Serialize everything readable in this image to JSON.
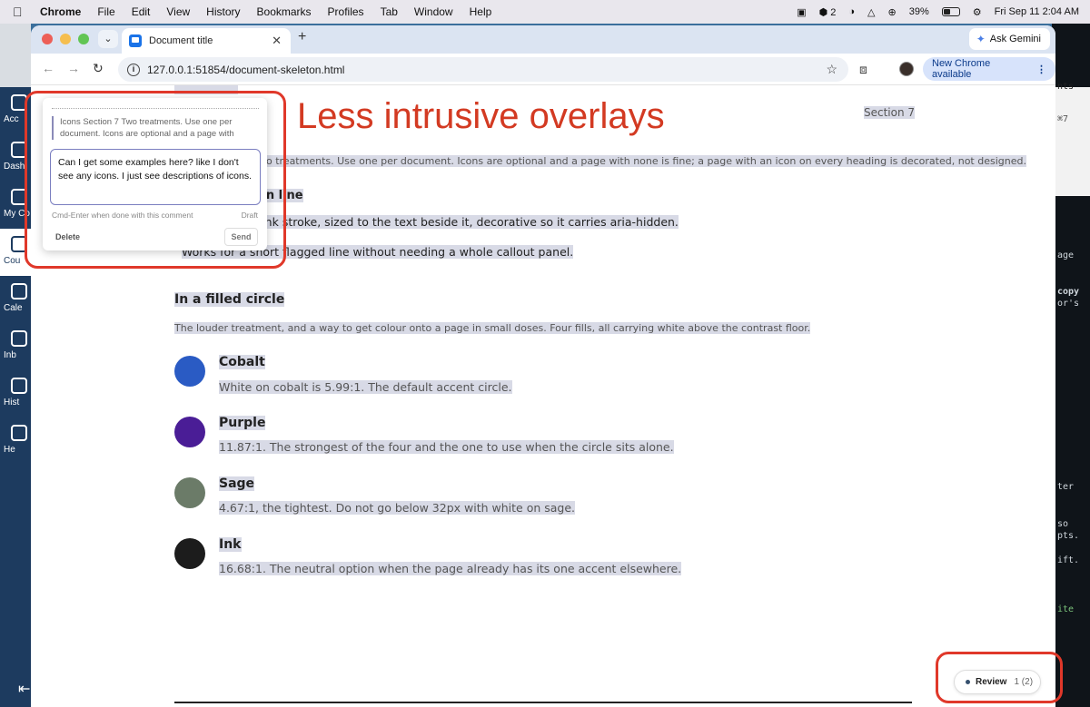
{
  "menubar": {
    "app": "Chrome",
    "items": [
      "File",
      "Edit",
      "View",
      "History",
      "Bookmarks",
      "Profiles",
      "Tab",
      "Window",
      "Help"
    ],
    "status_count": "2",
    "battery": "39%",
    "datetime": "Fri Sep 11  2:04 AM"
  },
  "left_app": {
    "items": [
      "Acc",
      "Dash",
      "My Co",
      "Cou",
      "Cale",
      "Inb",
      "Hist",
      "He"
    ],
    "active_index": 3
  },
  "right_app": {
    "lines": [
      "nts",
      "⌘7",
      "age",
      "copy",
      "or's",
      "ter",
      "so",
      "pts.",
      "ift.",
      "ite"
    ]
  },
  "browser": {
    "tab_title": "Document title",
    "ask_gemini": "Ask Gemini",
    "url": "127.0.0.1:51854/document-skeleton.html",
    "update_label": "New Chrome available"
  },
  "doc": {
    "section_label": "Section 7",
    "overlay_heading": "Less intrusive overlays",
    "intro": "Icons Section 7 Two treatments. Use one per document. Icons are optional and a page with none is fine; a page with an icon on every heading is decorated, not designed.",
    "inline_heading": "In line",
    "inline_text": "Ink stroke, sized to the text beside it, decorative so it carries aria-hidden.",
    "inline_text2": "Works for a short flagged line without needing a whole callout panel.",
    "circle_heading": "In a filled circle",
    "circle_text": "The louder treatment, and a way to get colour onto a page in small doses. Four fills, all carrying white above the contrast floor.",
    "colors": [
      {
        "name": "Cobalt",
        "desc": "White on cobalt is 5.99:1. The default accent circle.",
        "hex": "#2a5bc4"
      },
      {
        "name": "Purple",
        "desc": "11.87:1. The strongest of the four and the one to use when the circle sits alone.",
        "hex": "#4a1d96"
      },
      {
        "name": "Sage",
        "desc": "4.67:1, the tightest. Do not go below 32px with white on sage.",
        "hex": "#6b7b68"
      },
      {
        "name": "Ink",
        "desc": "16.68:1. The neutral option when the page already has its one accent elsewhere.",
        "hex": "#1c1c1c"
      }
    ]
  },
  "comment": {
    "quote": "Icons Section 7 Two treatments. Use one per document. Icons are optional and a page with",
    "text": "Can I get some examples here? like I don't see any icons. I just see descriptions of icons.",
    "hint": "Cmd-Enter when done with this comment",
    "status": "Draft",
    "delete_label": "Delete",
    "send_label": "Send"
  },
  "review": {
    "label": "Review",
    "count": "1 (2)"
  },
  "accent": "#e0382a"
}
